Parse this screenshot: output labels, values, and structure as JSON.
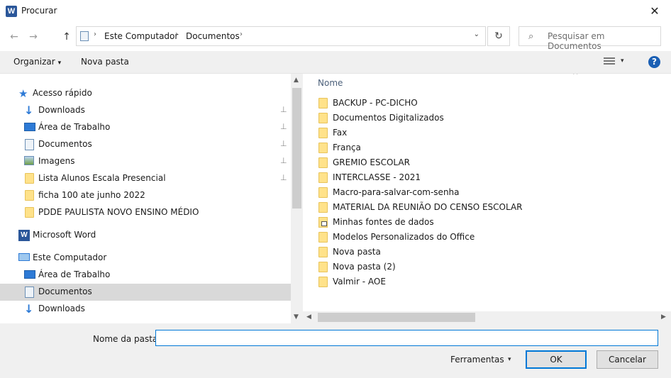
{
  "window": {
    "title": "Procurar",
    "app_icon": "W",
    "close_glyph": "✕"
  },
  "address": {
    "crumbs": [
      "Este Computador",
      "Documentos"
    ],
    "separator": "›",
    "back_glyph": "←",
    "forward_glyph": "→",
    "up_glyph": "↑",
    "dropdown_glyph": "⌄",
    "refresh_glyph": "↻"
  },
  "search": {
    "placeholder": "Pesquisar em Documentos",
    "icon_glyph": "⌕"
  },
  "toolbar": {
    "organize_label": "Organizar",
    "new_folder_label": "Nova pasta",
    "caret_glyph": "▾",
    "help_glyph": "?"
  },
  "sidebar": {
    "items": [
      {
        "label": "Acesso rápido",
        "icon": "star-icon",
        "pinned": false
      },
      {
        "label": "Downloads",
        "icon": "download-icon",
        "pinned": true
      },
      {
        "label": "Área de Trabalho",
        "icon": "desktop-icon",
        "pinned": true
      },
      {
        "label": "Documentos",
        "icon": "documents-icon",
        "pinned": true
      },
      {
        "label": "Imagens",
        "icon": "pictures-icon",
        "pinned": true
      },
      {
        "label": "Lista Alunos Escala Presencial",
        "icon": "folder-icon",
        "pinned": true
      },
      {
        "label": "ficha 100 ate junho 2022",
        "icon": "folder-icon",
        "pinned": false
      },
      {
        "label": "PDDE PAULISTA NOVO ENSINO MÉDIO",
        "icon": "folder-icon",
        "pinned": false
      },
      {
        "label": "Microsoft Word",
        "icon": "word-icon",
        "pinned": false
      },
      {
        "label": "Este Computador",
        "icon": "computer-icon",
        "pinned": false
      },
      {
        "label": "Área de Trabalho",
        "icon": "desktop-icon",
        "pinned": false
      },
      {
        "label": "Documentos",
        "icon": "documents-icon",
        "pinned": false,
        "selected": true
      },
      {
        "label": "Downloads",
        "icon": "download-icon",
        "pinned": false
      }
    ],
    "pin_glyph": "📌"
  },
  "files": {
    "column_header": "Nome",
    "sort_glyph": "^",
    "items": [
      {
        "name": "BACKUP - PC-DICHO",
        "type": "folder"
      },
      {
        "name": "Documentos Digitalizados",
        "type": "folder"
      },
      {
        "name": "Fax",
        "type": "folder"
      },
      {
        "name": "França",
        "type": "folder"
      },
      {
        "name": "GREMIO ESCOLAR",
        "type": "folder"
      },
      {
        "name": "INTERCLASSE - 2021",
        "type": "folder"
      },
      {
        "name": "Macro-para-salvar-com-senha",
        "type": "folder"
      },
      {
        "name": "MATERIAL DA REUNIÃO DO CENSO ESCOLAR",
        "type": "folder"
      },
      {
        "name": "Minhas fontes de dados",
        "type": "special-folder"
      },
      {
        "name": "Modelos Personalizados do Office",
        "type": "folder"
      },
      {
        "name": "Nova pasta",
        "type": "folder"
      },
      {
        "name": "Nova pasta (2)",
        "type": "folder"
      },
      {
        "name": "Valmir - AOE",
        "type": "folder"
      }
    ]
  },
  "footer": {
    "folder_label": "Nome da pasta:",
    "folder_value": "",
    "tools_label": "Ferramentas",
    "tools_caret": "▾",
    "ok_label": "OK",
    "cancel_label": "Cancelar"
  },
  "scroll": {
    "up_glyph": "▲",
    "down_glyph": "▼",
    "left_glyph": "◀",
    "right_glyph": "▶"
  },
  "colors": {
    "accent": "#0078d7",
    "selection": "#d9d9d9",
    "folder": "#ffe28a",
    "chrome": "#f0f0f0"
  }
}
